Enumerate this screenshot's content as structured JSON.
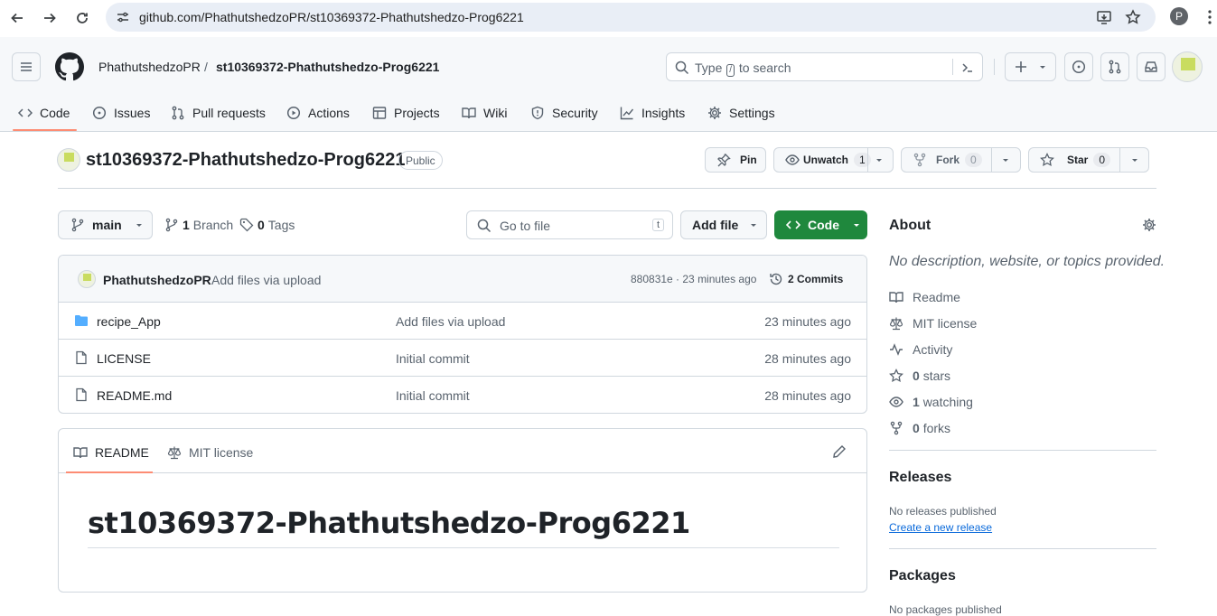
{
  "browser": {
    "url": "github.com/PhathutshedzoPR/st10369372-Phathutshedzo-Prog6221",
    "profile_initial": "P"
  },
  "header": {
    "owner": "PhathutshedzoPR",
    "separator": "/",
    "repo": "st10369372-Phathutshedzo-Prog6221",
    "search_pre": "Type",
    "search_key": "/",
    "search_post": "to search"
  },
  "tabs": [
    {
      "label": "Code",
      "icon": "code-icon"
    },
    {
      "label": "Issues",
      "icon": "issue-icon"
    },
    {
      "label": "Pull requests",
      "icon": "pull-request-icon"
    },
    {
      "label": "Actions",
      "icon": "play-icon"
    },
    {
      "label": "Projects",
      "icon": "table-icon"
    },
    {
      "label": "Wiki",
      "icon": "book-icon"
    },
    {
      "label": "Security",
      "icon": "shield-icon"
    },
    {
      "label": "Insights",
      "icon": "graph-icon"
    },
    {
      "label": "Settings",
      "icon": "gear-icon"
    }
  ],
  "repo": {
    "title": "st10369372-Phathutshedzo-Prog6221",
    "visibility": "Public",
    "pin": "Pin",
    "unwatch": "Unwatch",
    "watch_count": "1",
    "fork": "Fork",
    "fork_count": "0",
    "star": "Star",
    "star_count": "0"
  },
  "files_toolbar": {
    "branch": "main",
    "branch_count": "1",
    "branch_label": "Branch",
    "tag_count": "0",
    "tag_label": "Tags",
    "go_to_file": "Go to file",
    "go_to_key": "t",
    "add_file": "Add file",
    "code": "Code"
  },
  "commit": {
    "author": "PhathutshedzoPR",
    "message": "Add files via upload",
    "hash_time": "880831e · 23 minutes ago",
    "commits": "2 Commits"
  },
  "files": [
    {
      "name": "recipe_App",
      "type": "folder",
      "message": "Add files via upload",
      "time": "23 minutes ago"
    },
    {
      "name": "LICENSE",
      "type": "file",
      "message": "Initial commit",
      "time": "28 minutes ago"
    },
    {
      "name": "README.md",
      "type": "file",
      "message": "Initial commit",
      "time": "28 minutes ago"
    }
  ],
  "readme": {
    "tab_readme": "README",
    "tab_license": "MIT license",
    "heading": "st10369372-Phathutshedzo-Prog6221"
  },
  "about": {
    "title": "About",
    "description": "No description, website, or topics provided.",
    "readme": "Readme",
    "license": "MIT license",
    "activity": "Activity",
    "stars_count": "0",
    "stars_label": "stars",
    "watching_count": "1",
    "watching_label": "watching",
    "forks_count": "0",
    "forks_label": "forks"
  },
  "releases": {
    "title": "Releases",
    "none": "No releases published",
    "create": "Create a new release"
  },
  "packages": {
    "title": "Packages",
    "none": "No packages published"
  },
  "colors": {
    "accent_green": "#1f883d",
    "tab_underline": "#fd8c73",
    "link_blue": "#0969da",
    "folder_blue": "#54aeff"
  }
}
